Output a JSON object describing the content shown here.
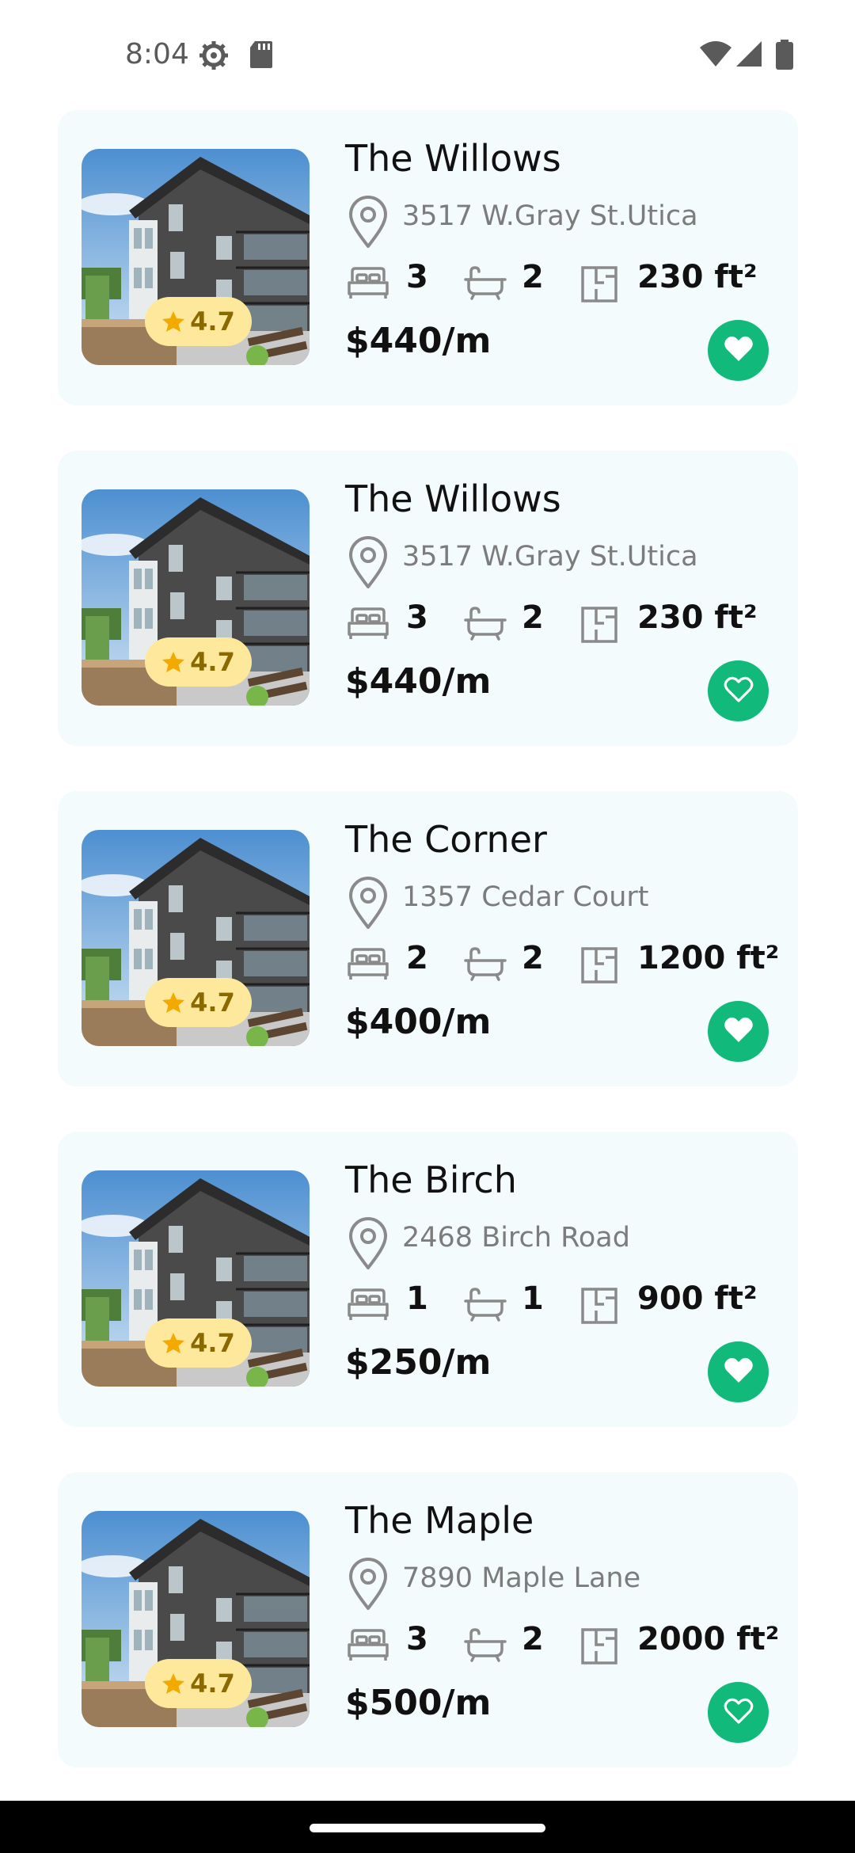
{
  "status_bar": {
    "time": "8:04",
    "icons": [
      "settings-icon",
      "sd-card-icon",
      "wifi-icon",
      "signal-icon",
      "battery-icon"
    ]
  },
  "colors": {
    "card_bg": "#f4fbfd",
    "accent_green": "#11b97a",
    "rating_bg": "#fde89b",
    "rating_star": "#f2a900"
  },
  "listings": [
    {
      "title": "The Willows",
      "address": "3517 W.Gray St.Utica",
      "beds": "3",
      "baths": "2",
      "area": "230 ft²",
      "price": "$440/m",
      "rating": "4.7",
      "favorited": true
    },
    {
      "title": "The Willows",
      "address": "3517 W.Gray St.Utica",
      "beds": "3",
      "baths": "2",
      "area": "230 ft²",
      "price": "$440/m",
      "rating": "4.7",
      "favorited": false
    },
    {
      "title": "The Corner",
      "address": "1357 Cedar Court",
      "beds": "2",
      "baths": "2",
      "area": "1200 ft²",
      "price": "$400/m",
      "rating": "4.7",
      "favorited": true
    },
    {
      "title": "The Birch",
      "address": "2468 Birch Road",
      "beds": "1",
      "baths": "1",
      "area": "900 ft²",
      "price": "$250/m",
      "rating": "4.7",
      "favorited": true
    },
    {
      "title": "The Maple",
      "address": "7890 Maple Lane",
      "beds": "3",
      "baths": "2",
      "area": "2000 ft²",
      "price": "$500/m",
      "rating": "4.7",
      "favorited": false
    }
  ]
}
